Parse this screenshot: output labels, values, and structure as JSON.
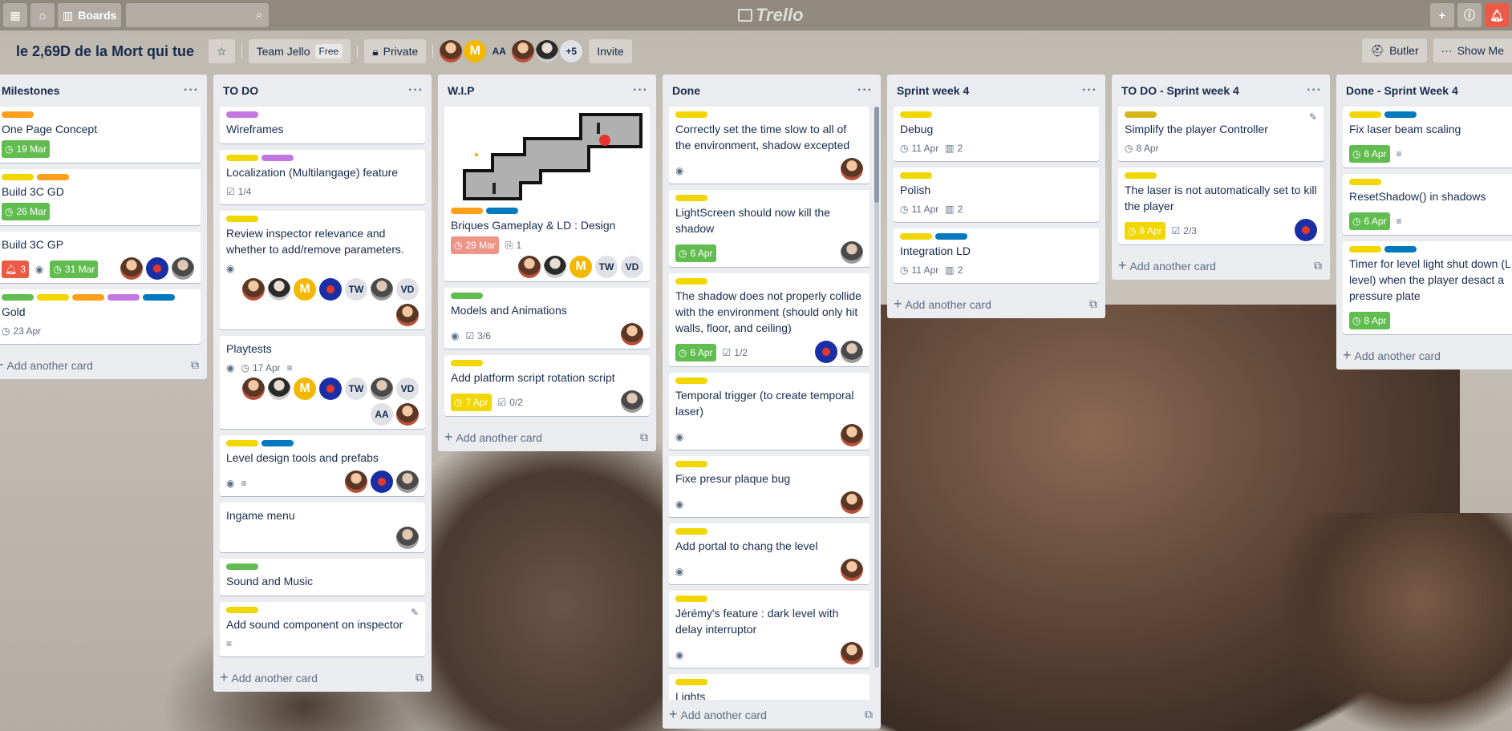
{
  "topbar": {
    "boards_label": "Boards",
    "logo": "Trello"
  },
  "board": {
    "title": "le 2,69D de la Mort qui tue",
    "team": "Team Jello",
    "team_badge": "Free",
    "visibility": "Private",
    "member_initials": "AA",
    "member_overflow": "+5",
    "invite": "Invite",
    "butler": "Butler",
    "show_menu": "Show Me"
  },
  "lists": [
    {
      "title": "Milestones",
      "add": "Add another card",
      "cards": [
        {
          "labels": [
            "orange"
          ],
          "title": "One Page Concept",
          "due": "19 Mar"
        },
        {
          "labels": [
            "yellow",
            "orange"
          ],
          "title": "Build 3C GD",
          "due": "26 Mar"
        },
        {
          "labels": [],
          "title": "Build 3C GP",
          "alerts": "3",
          "due": "31 Mar"
        },
        {
          "labels": [
            "green",
            "yellow",
            "orange",
            "purple",
            "blue"
          ],
          "title": "Gold",
          "due": "23 Apr"
        }
      ]
    },
    {
      "title": "TO DO",
      "add": "Add another card",
      "cards": [
        {
          "labels": [
            "purple"
          ],
          "title": "Wireframes"
        },
        {
          "labels": [
            "yellow",
            "purple"
          ],
          "title": "Localization (Multilangage) feature",
          "checklist": "1/4"
        },
        {
          "labels": [
            "yellow"
          ],
          "title": "Review inspector relevance and whether to add/remove parameters."
        },
        {
          "labels": [],
          "title": "Playtests",
          "date": "17 Apr"
        },
        {
          "labels": [
            "yellow",
            "blue"
          ],
          "title": "Level design tools and prefabs"
        },
        {
          "labels": [],
          "title": "Ingame menu"
        },
        {
          "labels": [
            "green"
          ],
          "title": "Sound and Music"
        },
        {
          "labels": [
            "yellow"
          ],
          "title": "Add sound component on inspector"
        }
      ],
      "initials": {
        "tw": "TW",
        "vd": "VD",
        "m": "M",
        "aa": "AA"
      }
    },
    {
      "title": "W.I.P",
      "add": "Add another card",
      "cards": [
        {
          "labels": [
            "orange",
            "blue"
          ],
          "title": "Briques Gameplay & LD : Design",
          "due": "29 Mar",
          "attachments": "1"
        },
        {
          "labels": [
            "green"
          ],
          "title": "Models and Animations",
          "checklist": "3/6"
        },
        {
          "labels": [
            "yellow"
          ],
          "title": "Add platform script rotation script",
          "due": "7 Apr",
          "checklist": "0/2"
        }
      ]
    },
    {
      "title": "Done",
      "add": "Add another card",
      "cards": [
        {
          "title": "Correctly set the time slow to all of the environment, shadow excepted"
        },
        {
          "title": "LightScreen should now kill the shadow",
          "due": "6 Apr"
        },
        {
          "title": "The shadow does not properly collide with the environment (should only hit walls, floor, and ceiling)",
          "due": "6 Apr",
          "checklist": "1/2"
        },
        {
          "title": "Temporal trigger (to create temporal laser)"
        },
        {
          "title": "Fixe presur plaque bug"
        },
        {
          "title": "Add portal to chang the level"
        },
        {
          "title": "Jérémy's feature : dark level with delay interruptor"
        },
        {
          "title": "Lights"
        }
      ]
    },
    {
      "title": "Sprint week 4",
      "add": "Add another card",
      "cards": [
        {
          "title": "Debug",
          "date": "11 Apr",
          "count": "2"
        },
        {
          "title": "Polish",
          "date": "11 Apr",
          "count": "2"
        },
        {
          "title": "Integration LD",
          "date": "11 Apr",
          "count": "2"
        }
      ]
    },
    {
      "title": "TO DO - Sprint week 4",
      "add": "Add another card",
      "cards": [
        {
          "title": "Simplify the player Controller",
          "date": "8 Apr"
        },
        {
          "title": "The laser is not automatically set to kill the player",
          "due": "8 Apr",
          "checklist": "2/3"
        }
      ]
    },
    {
      "title": "Done - Sprint Week 4",
      "add": "Add another card",
      "cards": [
        {
          "title": "Fix laser beam scaling",
          "due": "6 Apr"
        },
        {
          "title": "ResetShadow() in shadows",
          "due": "6 Apr"
        },
        {
          "title": "Timer for level light shut down (L Out level) when the player desact a pressure plate",
          "due": "8 Apr"
        }
      ]
    }
  ]
}
